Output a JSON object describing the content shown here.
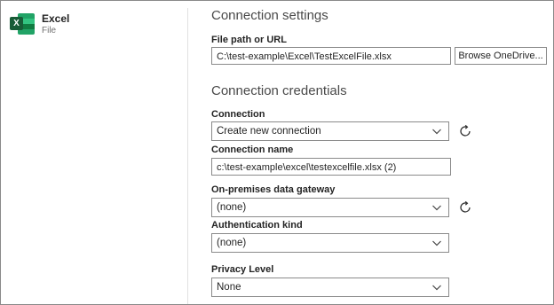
{
  "connector": {
    "name": "Excel",
    "subtitle": "File",
    "logo_letter": "X"
  },
  "settings": {
    "title": "Connection settings",
    "file_path_label": "File path or URL",
    "file_path_value": "C:\\test-example\\Excel\\TestExcelFile.xlsx",
    "browse_label": "Browse OneDrive..."
  },
  "credentials": {
    "title": "Connection credentials",
    "connection_label": "Connection",
    "connection_value": "Create new connection",
    "connection_name_label": "Connection name",
    "connection_name_value": "c:\\test-example\\excel\\testexcelfile.xlsx (2)",
    "gateway_label": "On-premises data gateway",
    "gateway_value": "(none)",
    "auth_label": "Authentication kind",
    "auth_value": "(none)",
    "privacy_label": "Privacy Level",
    "privacy_value": "None"
  },
  "icons": {
    "refresh": "refresh-icon",
    "chevron": "chevron-down-icon"
  }
}
